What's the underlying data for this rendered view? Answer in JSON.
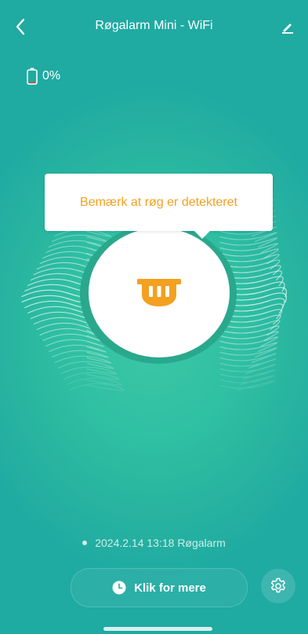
{
  "header": {
    "title": "Røgalarm Mini - WiFi",
    "back_icon": "chevron-left-icon",
    "edit_icon": "pencil-icon"
  },
  "battery": {
    "icon": "battery-icon",
    "label": "0%",
    "level": 0
  },
  "device": {
    "icon": "smoke-detector-icon",
    "status_message": "Bemærk at røg er detekteret"
  },
  "event": {
    "text": "2024.2.14 13:18 Røgalarm"
  },
  "actions": {
    "more_label": "Klik for mere",
    "more_icon": "clock-icon",
    "settings_icon": "gear-icon"
  },
  "colors": {
    "background": "#2fbfa2",
    "accent": "#f4a020",
    "ring": "#2aa88d",
    "battery_empty": "#e24b3b"
  }
}
